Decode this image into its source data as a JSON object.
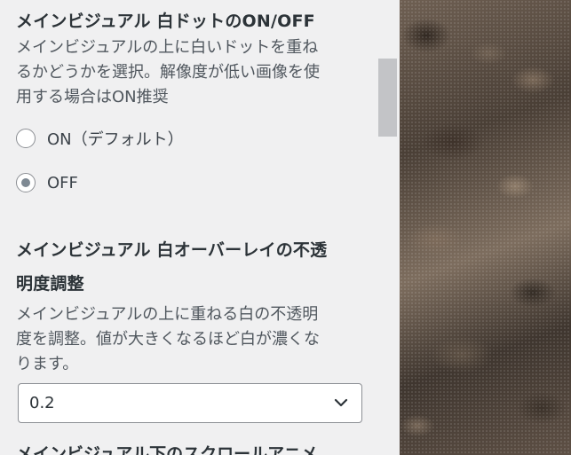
{
  "dots_section": {
    "title": "メインビジュアル 白ドットのON/OFF",
    "description_lines": [
      "メインビジュアルの上に白いドットを重ね",
      "るかどうかを選択。解像度が低い画像を使",
      "用する場合はON推奨"
    ],
    "options": [
      {
        "label": "ON（デフォルト）",
        "checked": false
      },
      {
        "label": "OFF",
        "checked": true
      }
    ]
  },
  "overlay_section": {
    "title_lines": [
      "メインビジュアル 白オーバーレイの不透",
      "明度調整"
    ],
    "description_lines": [
      "メインビジュアルの上に重ねる白の不透明",
      "度を調整。値が大きくなるほど白が濃くな",
      "ります。"
    ],
    "select_value": "0.2"
  },
  "next_section": {
    "title_partial": "メインビジュアル下のスクロールアニメ"
  },
  "icons": {
    "select_arrow": "chevron-down-icon"
  },
  "colors": {
    "panel_bg": "#f0f0f1",
    "scrollbar_thumb": "#c3c4c7",
    "radio_checked": "#7e8993"
  }
}
